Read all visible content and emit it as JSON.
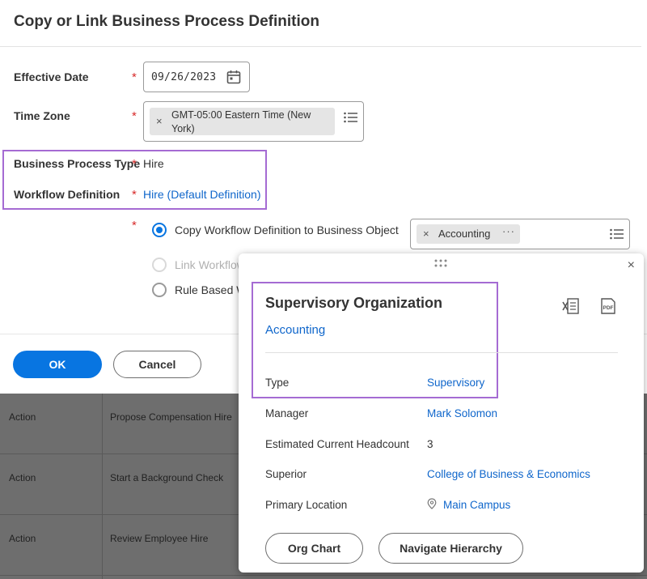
{
  "page": {
    "title": "Copy or Link Business Process Definition"
  },
  "form": {
    "effective_date": {
      "label": "Effective Date",
      "value": "09/26/2023"
    },
    "time_zone": {
      "label": "Time Zone",
      "value_line1": "GMT-05:00 Eastern Time (New",
      "value_line2": "York)"
    },
    "business_process_type": {
      "label": "Business Process Type",
      "value": "Hire"
    },
    "workflow_definition": {
      "label": "Workflow Definition",
      "value": "Hire (Default Definition)"
    },
    "required_mark": "*",
    "pill_remove": "×",
    "options": [
      {
        "label": "Copy Workflow Definition to Business Object",
        "checked": true
      },
      {
        "label": "Link Workflow",
        "checked": false,
        "disabled": true
      },
      {
        "label": "Rule Based W",
        "checked": false
      }
    ],
    "business_object": {
      "value": "Accounting",
      "more": "···"
    }
  },
  "actions": {
    "ok_label": "OK",
    "cancel_label": "Cancel"
  },
  "background_table": {
    "rows": [
      {
        "col1": "Action",
        "col2": "Propose Compensation Hire"
      },
      {
        "col1": "Action",
        "col2": "Start a Background Check"
      },
      {
        "col1": "Action",
        "col2": "Review Employee Hire"
      }
    ]
  },
  "popup": {
    "title": "Supervisory Organization",
    "subtitle": "Accounting",
    "close": "×",
    "fields": [
      {
        "label": "Type",
        "value": "Supervisory"
      },
      {
        "label": "Manager",
        "value": "Mark Solomon"
      },
      {
        "label": "Estimated Current Headcount",
        "value": "3"
      },
      {
        "label": "Superior",
        "value": "College of Business & Economics"
      },
      {
        "label": "Primary Location",
        "value": "Main Campus"
      }
    ],
    "buttons": {
      "org_chart": "Org Chart",
      "navigate_hierarchy": "Navigate Hierarchy"
    }
  },
  "colors": {
    "accent": "#0875e1",
    "link": "#0f66cb",
    "required": "#d72a2a",
    "highlight": "#a56bd3"
  }
}
